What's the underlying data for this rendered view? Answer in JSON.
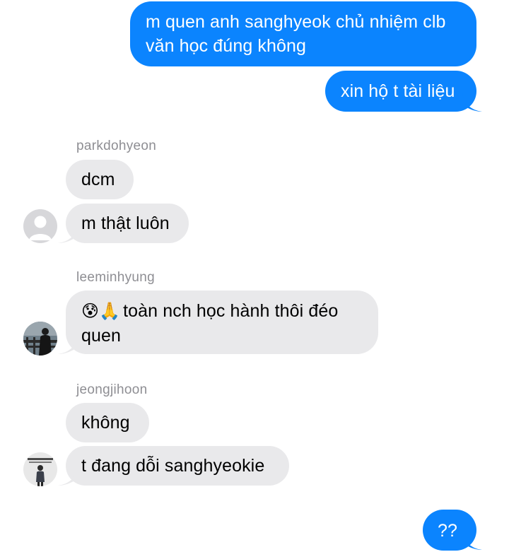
{
  "messages": {
    "sent_1": "m quen anh sanghyeok chủ nhiệm clb văn học đúng không",
    "sent_2": "xin hộ t tài liệu",
    "sent_3": "??"
  },
  "threads": {
    "user1": {
      "name": "parkdohyeon",
      "msg_1": "dcm",
      "msg_2": "m thật luôn"
    },
    "user2": {
      "name": "leeminhyung",
      "emojis": "😰🙏",
      "msg_1": "toàn nch học hành thôi đéo quen"
    },
    "user3": {
      "name": "jeongjihoon",
      "msg_1": "không",
      "msg_2": "t đang dỗi sanghyeokie"
    }
  },
  "colors": {
    "sent_bubble": "#0b84fe",
    "received_bubble": "#e9e9eb",
    "sender_name": "#8e8e93"
  }
}
